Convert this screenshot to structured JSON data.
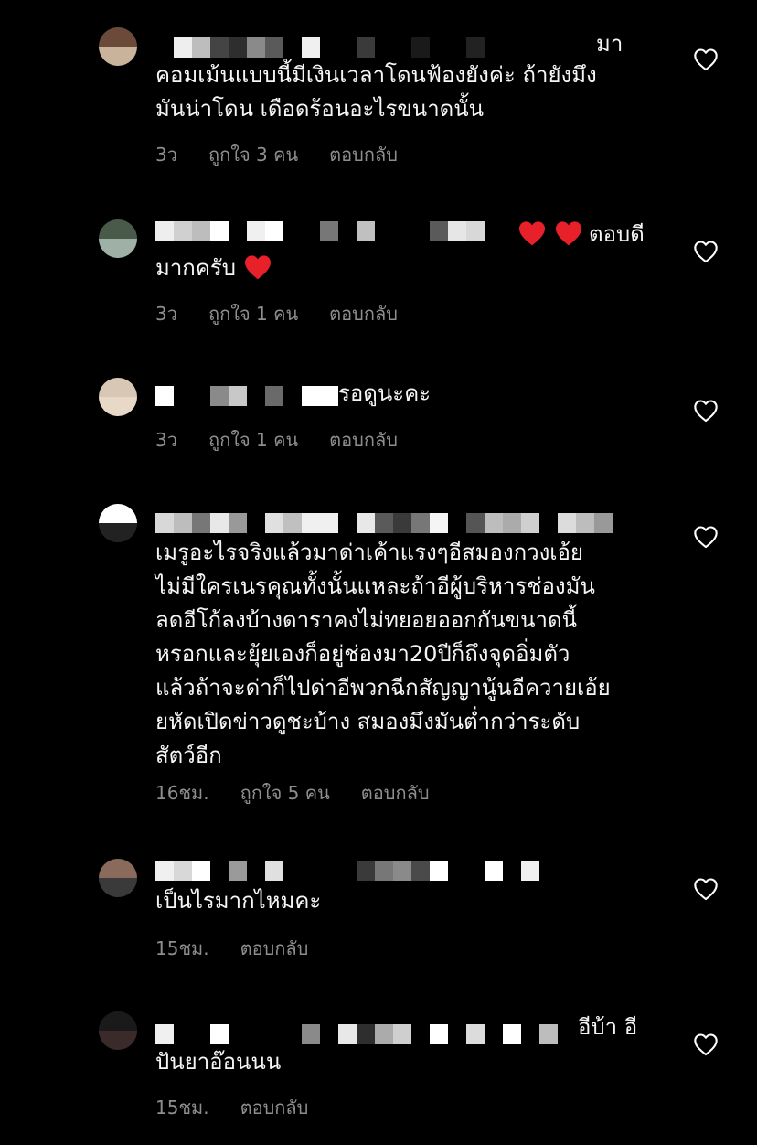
{
  "comments": [
    {
      "text_tail": "มา",
      "text": "คอมเม้นแบบนี้มีเงินเวลาโดนฟ้องยังค่ะ ถ้ายังมึง\nมันน่าโดน เดือดร้อนอะไรขนาดนั้น",
      "time": "3ว",
      "likes": "ถูกใจ 3 คน",
      "reply": "ตอบกลับ"
    },
    {
      "text_tail": "ตอบดี",
      "text_line2": "มากครับ",
      "time": "3ว",
      "likes": "ถูกใจ 1 คน",
      "reply": "ตอบกลับ"
    },
    {
      "text_tail": "รอดูนะคะ",
      "time": "3ว",
      "likes": "ถูกใจ 1 คน",
      "reply": "ตอบกลับ"
    },
    {
      "text": "เมรูอะไรจริงแล้วมาด่าเค้าแรงๆอีสมองกวงเอ้ย\nไม่มีใครเนรคุณทั้งนั้นแหละถ้าอีผู้บริหารช่องมัน\nลดอีโก้ลงบ้างดาราคงไม่ทยอยออกกันขนาดนี้\nหรอกและยุ้ยเองก็อยู่ช่องมา20ปีก็ถึงจุดอิ่มตัว\nแล้วถ้าจะด่าก็ไปด่าอีพวกฉีกสัญญานู้นอีควายเอ้ย\nยหัดเปิดข่าวดูชะบ้าง สมองมึงมันต่ำกว่าระดับ\nสัตว์อีก",
      "time": "16ชม.",
      "likes": "ถูกใจ 5 คน",
      "reply": "ตอบกลับ"
    },
    {
      "text": "เป็นไรมากไหมคะ",
      "time": "15ชม.",
      "reply": "ตอบกลับ"
    },
    {
      "text_tail": "อีบ้า อี",
      "text_line2": "ปันยาอ๊อนนน",
      "time": "15ชม.",
      "reply": "ตอบกลับ"
    }
  ],
  "icons": {
    "like": "heart-outline-icon",
    "emoji": "red-heart-emoji"
  },
  "colors": {
    "background": "#000000",
    "text": "#f5f5f5",
    "meta": "#8e8e8e",
    "heart_emoji": "#e8202a"
  }
}
